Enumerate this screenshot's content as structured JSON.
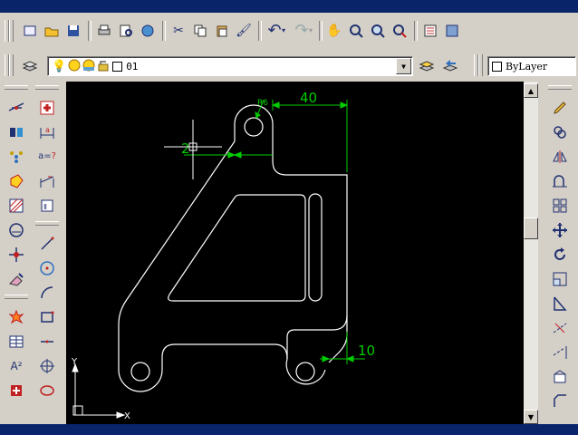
{
  "layer_toolbar": {
    "layer_name": "01",
    "color_value": "ByLayer"
  },
  "drawing": {
    "dim_radius": "R6",
    "dim_40": "40",
    "dim_2": "2",
    "dim_10": "10",
    "ucs_y": "Y",
    "ucs_x": "X"
  },
  "colors": {
    "title_bar": "#0a246a",
    "toolbar_face": "#d4d0c8",
    "canvas_bg": "#000000",
    "geometry_line": "#ffffff",
    "dimension_line": "#00cc00"
  }
}
